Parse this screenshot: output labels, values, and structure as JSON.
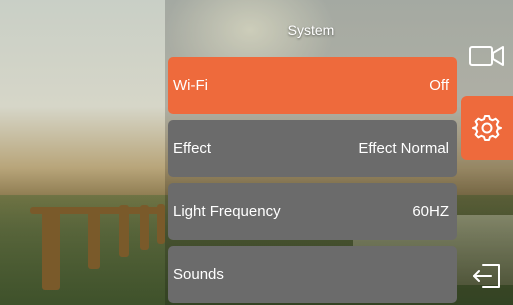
{
  "screen": {
    "title": "System"
  },
  "menu": {
    "items": [
      {
        "label": "Wi-Fi",
        "value": "Off",
        "selected": true
      },
      {
        "label": "Effect",
        "value": "Effect Normal",
        "selected": false
      },
      {
        "label": "Light Frequency",
        "value": "60HZ",
        "selected": false
      },
      {
        "label": "Sounds",
        "value": "",
        "selected": false
      }
    ]
  },
  "sidebar": {
    "items": [
      {
        "icon": "video-camera-icon"
      },
      {
        "icon": "gear-icon",
        "selected": true
      },
      {
        "icon": "exit-icon"
      }
    ]
  },
  "colors": {
    "accent": "#ee6a3c",
    "row_background": "#6b6b6b",
    "text": "#ffffff"
  }
}
